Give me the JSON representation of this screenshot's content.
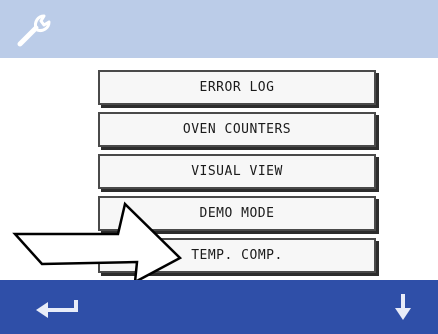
{
  "header": {
    "icon": "wrench-icon",
    "color": "#bbcce8"
  },
  "menu": {
    "items": [
      {
        "label": "ERROR LOG"
      },
      {
        "label": "OVEN COUNTERS"
      },
      {
        "label": "VISUAL VIEW"
      },
      {
        "label": "DEMO MODE"
      },
      {
        "label": "TEMP. COMP."
      }
    ]
  },
  "footer": {
    "color": "#2f4fa8",
    "back_icon": "back-arrow-icon",
    "down_icon": "down-arrow-icon"
  },
  "overlay": {
    "icon": "pointer-arrow-icon",
    "target": "TEMP. COMP."
  }
}
